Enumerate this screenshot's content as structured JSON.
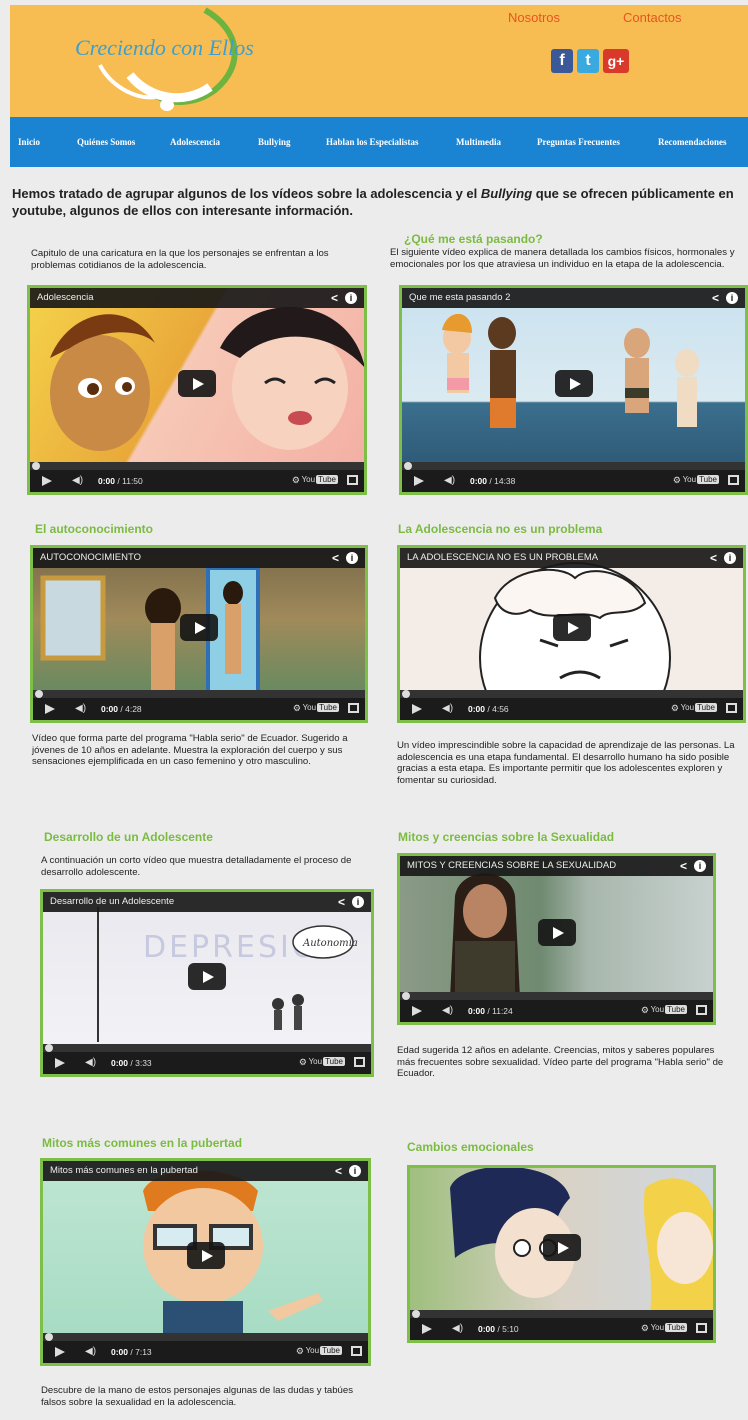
{
  "header": {
    "logo_text": "Creciendo con Ellos",
    "links": [
      "Nosotros",
      "Contactos"
    ],
    "social": [
      {
        "icon": "facebook-icon",
        "glyph": "f"
      },
      {
        "icon": "twitter-icon",
        "glyph": "t"
      },
      {
        "icon": "google-plus-icon",
        "glyph": "g+"
      }
    ]
  },
  "nav": [
    "Inicio",
    "Quiénes Somos",
    "Adolescencia",
    "Bullying",
    "Hablan los Especialistas",
    "Multimedia",
    "Preguntas Frecuentes",
    "Recomendaciones"
  ],
  "intro": {
    "part1": "Hemos tratado de agrupar algunos de los vídeos sobre la adolescencia y el ",
    "emph": "Bullying",
    "part2": " que se ofrecen públicamente en youtube, algunos de ellos con interesante información."
  },
  "sections": [
    {
      "title": "",
      "desc": "Capitulo de una caricatura en la que los personajes se enfrentan a los problemas cotidianos de la adolescencia.",
      "video_title": "Adolescencia",
      "time_current": "0:00",
      "time_total": "/ 11:50"
    },
    {
      "title": "¿Qué me está pasando?",
      "desc": "El siguiente vídeo explica de manera detallada los cambios físicos, hormonales y emocionales por los que atraviesa un individuo en la etapa de la adolescencia.",
      "video_title": "Que me esta pasando 2",
      "time_current": "0:00",
      "time_total": "/ 14:38"
    },
    {
      "title": "El autoconocimiento",
      "desc": "Vídeo que forma parte del programa \"Habla serio\" de Ecuador. Sugerido a jóvenes de 10 años en adelante. Muestra la exploración del cuerpo y sus sensaciones ejemplificada en un caso femenino y otro masculino.",
      "video_title": "AUTOCONOCIMIENTO",
      "time_current": "0:00",
      "time_total": "/ 4:28"
    },
    {
      "title": "La Adolescencia no es un problema",
      "desc": "Un vídeo imprescindible sobre la capacidad de aprendizaje de las personas. La adolescencia es una etapa fundamental. El desarrollo humano ha sido posible gracias a esta etapa. Es importante permitir que los adolescentes exploren y fomentar su curiosidad.",
      "video_title": "LA ADOLESCENCIA NO ES UN PROBLEMA",
      "time_current": "0:00",
      "time_total": "/ 4:56"
    },
    {
      "title": "Desarrollo de un Adolescente",
      "desc": "A continuación un corto vídeo que muestra detalladamente el proceso de desarrollo adolescente.",
      "video_title": "Desarrollo de un Adolescente",
      "overlay_main": "DEPRESIÓN",
      "overlay_bubble": "Autonomía",
      "time_current": "0:00",
      "time_total": "/ 3:33"
    },
    {
      "title": "Mitos y creencias sobre la Sexualidad",
      "desc": "Edad sugerida 12 años en adelante. Creencias, mitos y saberes populares más frecuentes sobre sexualidad. Vídeo parte del programa \"Habla serio\" de Ecuador.",
      "video_title": "MITOS Y CREENCIAS SOBRE LA SEXUALIDAD",
      "time_current": "0:00",
      "time_total": "/ 11:24"
    },
    {
      "title": "Mitos más comunes en la pubertad",
      "desc": "Descubre de la mano de estos personajes algunas de las dudas y tabúes falsos sobre la sexualidad en la adolescencia.",
      "video_title": "Mitos más comunes en la pubertad",
      "time_current": "0:00",
      "time_total": "/ 7:13"
    },
    {
      "title": "Cambios emocionales",
      "desc": "",
      "video_title": "",
      "time_current": "0:00",
      "time_total": "/ 5:10"
    }
  ],
  "player": {
    "youtube_label": "You",
    "youtube_box": "Tube"
  },
  "colors": {
    "header_bg": "#f8bd52",
    "nav_bg": "#1b84d2",
    "accent_green": "#7dbf49",
    "link_orange": "#e8541f"
  }
}
